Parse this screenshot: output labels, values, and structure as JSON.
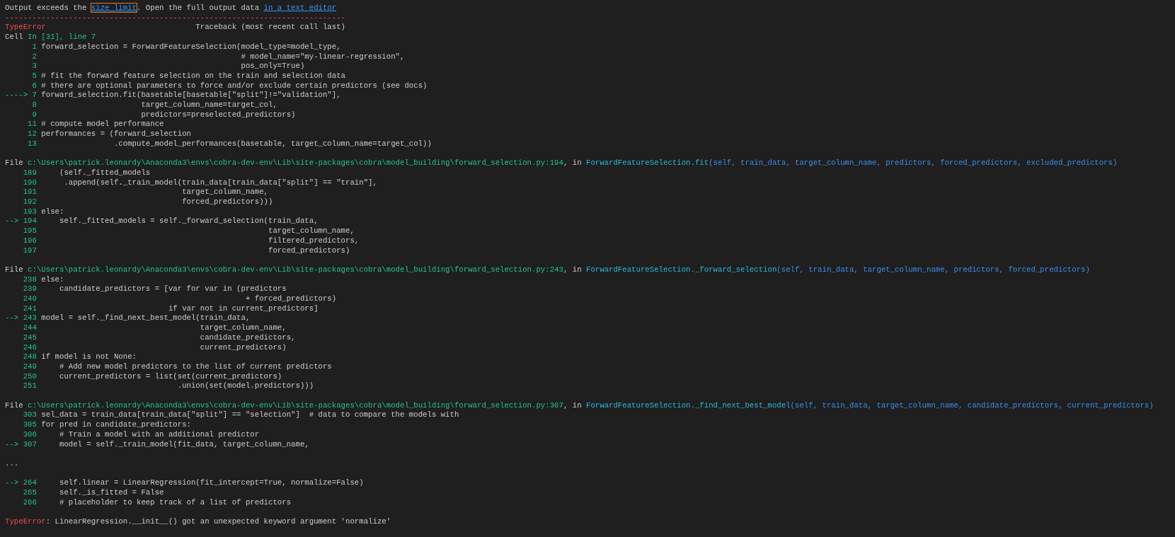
{
  "notice": {
    "parts": [
      {
        "kind": "text",
        "text": "Output exceeds the "
      },
      {
        "kind": "link",
        "text": "size limit",
        "focused": true
      },
      {
        "kind": "text",
        "text": ". Open the full output data "
      },
      {
        "kind": "link",
        "text": "in a text editor",
        "focused": false
      }
    ]
  },
  "separator": "---------------------------------------------------------------------------",
  "exception_header": {
    "type": "TypeError",
    "traceback_label": "Traceback (most recent call last)"
  },
  "cell_ref": {
    "label": "Cell",
    "location": "In [31], line 7"
  },
  "blocks": [
    {
      "kind": "frame",
      "lines": [
        {
          "number": "1",
          "code": "forward_selection = ForwardFeatureSelection(model_type=model_type,"
        },
        {
          "number": "2",
          "code": "                                            # model_name=\"my-linear-regression\","
        },
        {
          "number": "3",
          "code": "                                            pos_only=True)"
        },
        {
          "number": "5",
          "code": "# fit the forward feature selection on the train and selection data"
        },
        {
          "number": "6",
          "code": "# there are optional parameters to force and/or exclude certain predictors (see docs)"
        },
        {
          "arrow": "---->",
          "number": "7",
          "code": "forward_selection.fit(basetable[basetable[\"split\"]!=\"validation\"],"
        },
        {
          "number": "8",
          "code": "                      target_column_name=target_col,"
        },
        {
          "number": "9",
          "code": "                      predictors=preselected_predictors)"
        },
        {
          "number": "11",
          "code": "# compute model performance"
        },
        {
          "number": "12",
          "code": "performances = (forward_selection"
        },
        {
          "number": "13",
          "code": "                .compute_model_performances(basetable, target_column_name=target_col))"
        }
      ]
    },
    {
      "kind": "frame",
      "file": {
        "label": "File",
        "path": "c:\\Users\\patrick.leonardy\\Anaconda3\\envs\\cobra-dev-env\\Lib\\site-packages\\cobra\\model_building\\forward_selection.py:194",
        "in_label": ", in",
        "function": "ForwardFeatureSelection.fit",
        "signature": "(self, train_data, target_column_name, predictors, forced_predictors, excluded_predictors)"
      },
      "lines": [
        {
          "number": "189",
          "code": "    (self._fitted_models"
        },
        {
          "number": "190",
          "code": "     .append(self._train_model(train_data[train_data[\"split\"] == \"train\"],"
        },
        {
          "number": "191",
          "code": "                               target_column_name,"
        },
        {
          "number": "192",
          "code": "                               forced_predictors)))"
        },
        {
          "number": "193",
          "code": "else:"
        },
        {
          "arrow": "-->",
          "number": "194",
          "code": "    self._fitted_models = self._forward_selection(train_data,"
        },
        {
          "number": "195",
          "code": "                                                  target_column_name,"
        },
        {
          "number": "196",
          "code": "                                                  filtered_predictors,"
        },
        {
          "number": "197",
          "code": "                                                  forced_predictors)"
        }
      ]
    },
    {
      "kind": "frame",
      "file": {
        "label": "File",
        "path": "c:\\Users\\patrick.leonardy\\Anaconda3\\envs\\cobra-dev-env\\Lib\\site-packages\\cobra\\model_building\\forward_selection.py:243",
        "in_label": ", in",
        "function": "ForwardFeatureSelection._forward_selection",
        "signature": "(self, train_data, target_column_name, predictors, forced_predictors)"
      },
      "lines": [
        {
          "number": "238",
          "code": "else:"
        },
        {
          "number": "239",
          "code": "    candidate_predictors = [var for var in (predictors"
        },
        {
          "number": "240",
          "code": "                                             + forced_predictors)"
        },
        {
          "number": "241",
          "code": "                            if var not in current_predictors]"
        },
        {
          "arrow": "-->",
          "number": "243",
          "code": "model = self._find_next_best_model(train_data,"
        },
        {
          "number": "244",
          "code": "                                   target_column_name,"
        },
        {
          "number": "245",
          "code": "                                   candidate_predictors,"
        },
        {
          "number": "246",
          "code": "                                   current_predictors)"
        },
        {
          "number": "248",
          "code": "if model is not None:"
        },
        {
          "number": "249",
          "code": "    # Add new model predictors to the list of current predictors"
        },
        {
          "number": "250",
          "code": "    current_predictors = list(set(current_predictors)"
        },
        {
          "number": "251",
          "code": "                              .union(set(model.predictors)))"
        }
      ]
    },
    {
      "kind": "frame",
      "file": {
        "label": "File",
        "path": "c:\\Users\\patrick.leonardy\\Anaconda3\\envs\\cobra-dev-env\\Lib\\site-packages\\cobra\\model_building\\forward_selection.py:307",
        "in_label": ", in",
        "function": "ForwardFeatureSelection._find_next_best_model",
        "signature": "(self, train_data, target_column_name, candidate_predictors, current_predictors)"
      },
      "lines": [
        {
          "number": "303",
          "code": "sel_data = train_data[train_data[\"split\"] == \"selection\"]  # data to compare the models with"
        },
        {
          "number": "305",
          "code": "for pred in candidate_predictors:"
        },
        {
          "number": "306",
          "code": "    # Train a model with an additional predictor"
        },
        {
          "arrow": "-->",
          "number": "307",
          "code": "    model = self._train_model(fit_data, target_column_name,"
        }
      ]
    },
    {
      "kind": "ellipsis",
      "text": "..."
    },
    {
      "kind": "frame",
      "lines": [
        {
          "arrow": "-->",
          "number": "264",
          "code": "    self.linear = LinearRegression(fit_intercept=True, normalize=False)"
        },
        {
          "number": "265",
          "code": "    self._is_fitted = False"
        },
        {
          "number": "266",
          "code": "    # placeholder to keep track of a list of predictors"
        }
      ]
    }
  ],
  "error": {
    "type": "TypeError",
    "message": ": LinearRegression.__init__() got an unexpected keyword argument 'normalize'"
  }
}
